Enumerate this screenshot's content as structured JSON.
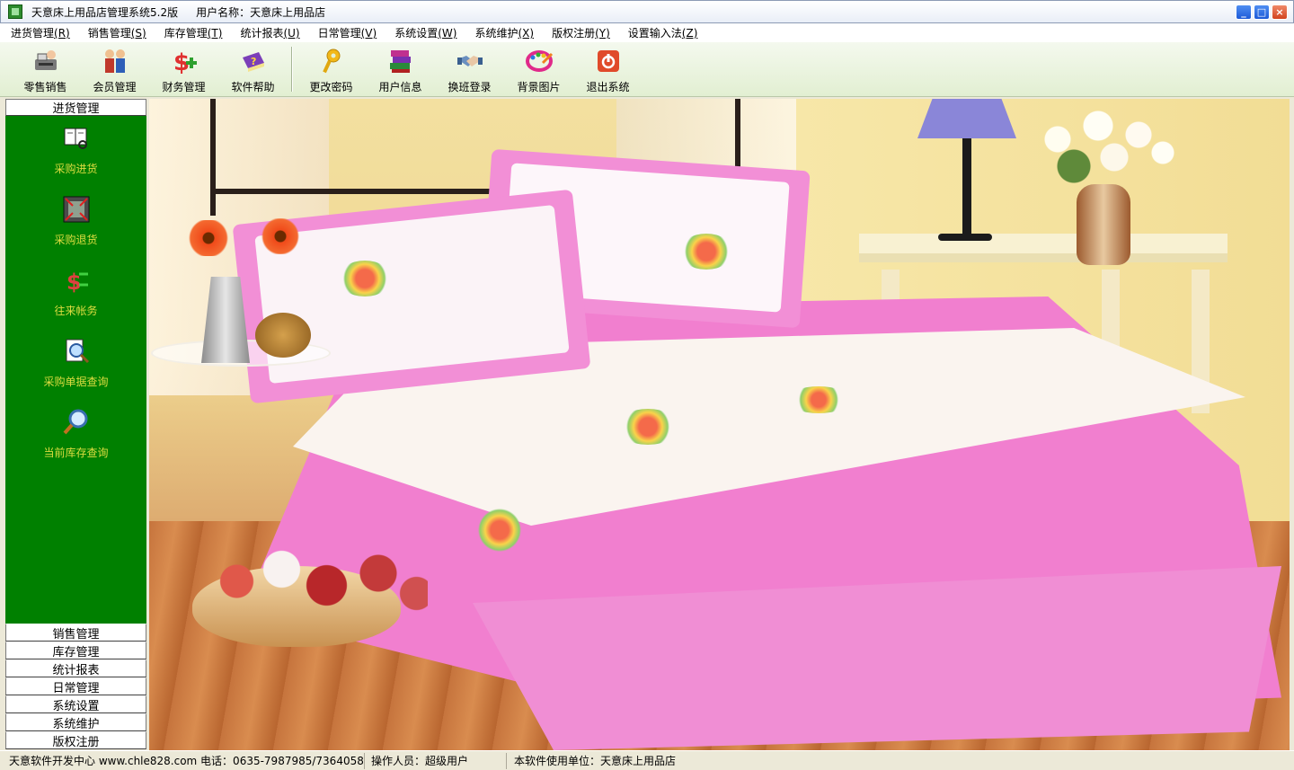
{
  "window": {
    "title": "天意床上用品店管理系统5.2版",
    "user_label": "用户名称：天意床上用品店",
    "buttons": {
      "minimize": "_",
      "maximize": "□",
      "close": "×"
    }
  },
  "menu": [
    {
      "label": "进货管理",
      "key": "(R)"
    },
    {
      "label": "销售管理",
      "key": "(S)"
    },
    {
      "label": "库存管理",
      "key": "(T)"
    },
    {
      "label": "统计报表",
      "key": "(U)"
    },
    {
      "label": "日常管理",
      "key": "(V)"
    },
    {
      "label": "系统设置",
      "key": "(W)"
    },
    {
      "label": "系统维护",
      "key": "(X)"
    },
    {
      "label": "版权注册",
      "key": "(Y)"
    },
    {
      "label": "设置输入法",
      "key": "(Z)"
    }
  ],
  "toolbar": {
    "group1": [
      {
        "label": "零售销售",
        "icon": "cashier-icon"
      },
      {
        "label": "会员管理",
        "icon": "members-icon"
      },
      {
        "label": "财务管理",
        "icon": "finance-icon"
      },
      {
        "label": "软件帮助",
        "icon": "help-book-icon"
      }
    ],
    "group2": [
      {
        "label": "更改密码",
        "icon": "key-icon"
      },
      {
        "label": "用户信息",
        "icon": "books-icon"
      },
      {
        "label": "换班登录",
        "icon": "handshake-icon"
      },
      {
        "label": "背景图片",
        "icon": "palette-icon"
      },
      {
        "label": "退出系统",
        "icon": "power-icon"
      }
    ]
  },
  "sidebar": {
    "active_section": "进货管理",
    "items": [
      {
        "label": "采购进货",
        "icon": "purchase-book-icon"
      },
      {
        "label": "采购退货",
        "icon": "return-icon"
      },
      {
        "label": "往来帐务",
        "icon": "accounts-icon"
      },
      {
        "label": "采购单据查询",
        "icon": "doc-search-icon"
      },
      {
        "label": "当前库存查询",
        "icon": "magnifier-icon"
      }
    ],
    "sections": [
      "销售管理",
      "库存管理",
      "统计报表",
      "日常管理",
      "系统设置",
      "系统维护",
      "版权注册"
    ]
  },
  "status": {
    "developer": "天意软件开发中心 www.chle828.com 电话：0635-7987985/7364058",
    "operator": "操作人员：超级用户",
    "unit": "本软件使用单位：天意床上用品店"
  },
  "colors": {
    "sidebar_green": "#008000",
    "sidebar_text": "#dcdc40",
    "quilt_pink": "#f17fcf"
  }
}
